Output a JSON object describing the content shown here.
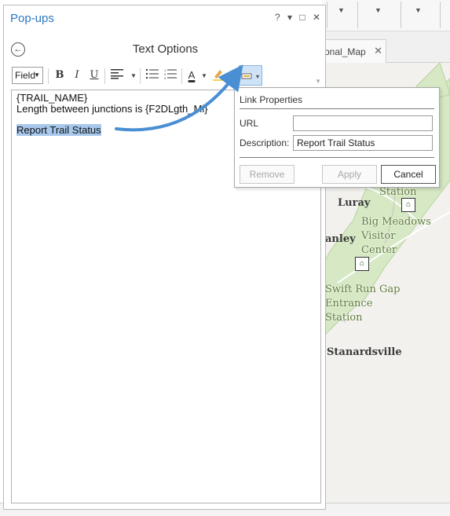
{
  "app": {
    "map_tab_label": "onal_Map",
    "map_tab_close": "✕"
  },
  "map": {
    "labels": {
      "station_top": "Station",
      "luray": "Luray",
      "big_meadows": "Big Meadows",
      "visitor": "Visitor",
      "center": "Center",
      "stanley": "anley",
      "swift_run": "Swift Run Gap",
      "entrance": "Entrance",
      "station_bottom": "Station",
      "stanardsville": "Stanardsville"
    },
    "colors": {
      "park": "#d6e8c4",
      "park_edge": "#b8d39e",
      "land": "#f2f1ee",
      "road": "#ffffff"
    }
  },
  "popups_pane": {
    "title": "Pop-ups",
    "controls": {
      "help": "?",
      "menu": "▾",
      "restore": "□",
      "close": "✕"
    },
    "back_icon": "←",
    "section_title": "Text Options",
    "toolbar": {
      "field_label": "Field",
      "bold": "B",
      "italic": "I",
      "underline": "U",
      "font_color_glyph": "A"
    },
    "editor": {
      "line1": "{TRAIL_NAME}",
      "line2": "Length between junctions is {F2DLgth_Mi}",
      "selected_text": "Report Trail Status"
    }
  },
  "link_properties": {
    "title": "Link Properties",
    "url_label": "URL",
    "url_value": "",
    "description_label": "Description:",
    "description_value": "Report Trail Status",
    "remove_label": "Remove",
    "apply_label": "Apply",
    "cancel_label": "Cancel"
  },
  "colors": {
    "accent": "#2a78c2",
    "selection": "#a7c8ec",
    "arrow": "#4a8fd4"
  }
}
